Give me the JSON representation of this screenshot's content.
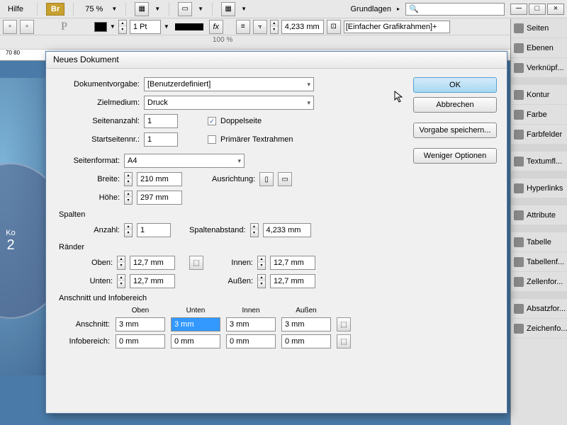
{
  "topbar": {
    "help": "Hilfe",
    "br": "Br",
    "zoom": "75 %",
    "workspace": "Grundlagen",
    "search_placeholder": ""
  },
  "toolbar2": {
    "stroke": "1 Pt",
    "measure": "4,233 mm",
    "frame": "[Einfacher Grafikrahmen]+",
    "pct": "100 %"
  },
  "ruler": "70      80",
  "canvas": {
    "t1": "Ko",
    "t2": "2"
  },
  "panels": [
    "Seiten",
    "Ebenen",
    "Verknüpf...",
    "Kontur",
    "Farbe",
    "Farbfelder",
    "Textumfl...",
    "Hyperlinks",
    "Attribute",
    "Tabelle",
    "Tabellenf...",
    "Zellenfor...",
    "Absatzfor...",
    "Zeichenfo..."
  ],
  "dialog": {
    "title": "Neues Dokument",
    "labels": {
      "vorgabe": "Dokumentvorgabe:",
      "ziel": "Zielmedium:",
      "seiten": "Seitenanzahl:",
      "start": "Startseitennr.:",
      "doppel": "Doppelseite",
      "primR": "Primärer Textrahmen",
      "format": "Seitenformat:",
      "breite": "Breite:",
      "hoehe": "Höhe:",
      "ausrichtung": "Ausrichtung:",
      "spalten": "Spalten",
      "anzahl": "Anzahl:",
      "spaltenabst": "Spaltenabstand:",
      "raender": "Ränder",
      "oben": "Oben:",
      "unten": "Unten:",
      "innen": "Innen:",
      "aussen": "Außen:",
      "anschnitt_sec": "Anschnitt und Infobereich",
      "anschnitt": "Anschnitt:",
      "info": "Infobereich:"
    },
    "values": {
      "vorgabe": "[Benutzerdefiniert]",
      "ziel": "Druck",
      "seiten": "1",
      "start": "1",
      "format": "A4",
      "breite": "210 mm",
      "hoehe": "297 mm",
      "anzahl": "1",
      "spaltenabst": "4,233 mm",
      "oben": "12,7 mm",
      "unten": "12,7 mm",
      "innen": "12,7 mm",
      "aussen": "12,7 mm",
      "a_oben": "3 mm",
      "a_unten": "3 mm",
      "a_innen": "3 mm",
      "a_aussen": "3 mm",
      "i_oben": "0 mm",
      "i_unten": "0 mm",
      "i_innen": "0 mm",
      "i_aussen": "0 mm"
    },
    "headers": {
      "oben": "Oben",
      "unten": "Unten",
      "innen": "Innen",
      "aussen": "Außen"
    },
    "buttons": {
      "ok": "OK",
      "cancel": "Abbrechen",
      "save": "Vorgabe speichern...",
      "less": "Weniger Optionen"
    }
  }
}
